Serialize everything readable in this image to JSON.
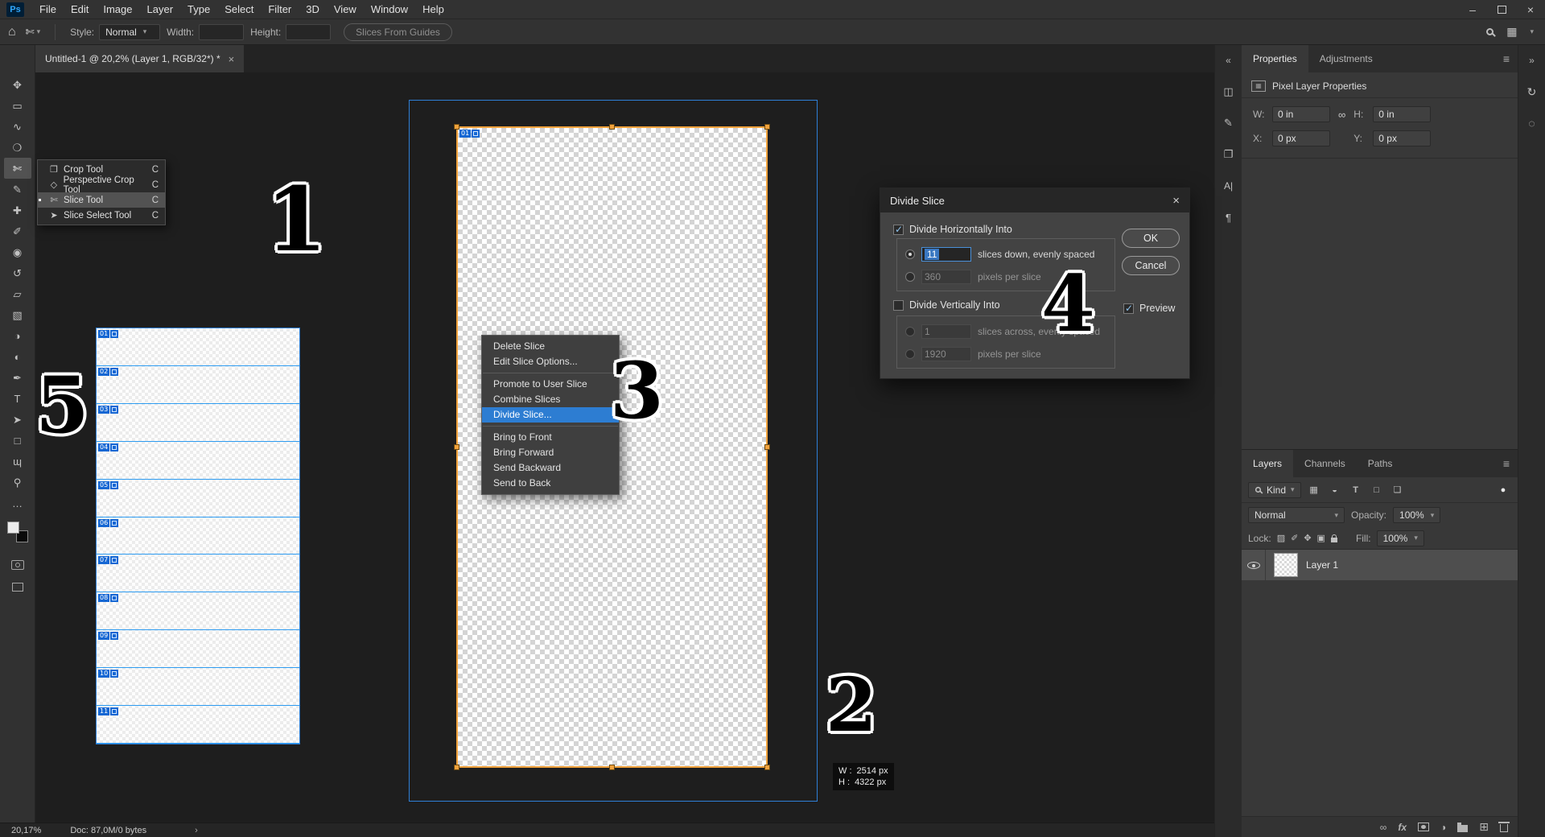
{
  "window": {
    "minimize_label": "–",
    "close_label": "×"
  },
  "menubar": {
    "logo": "Ps",
    "items": [
      "File",
      "Edit",
      "Image",
      "Layer",
      "Type",
      "Select",
      "Filter",
      "3D",
      "View",
      "Window",
      "Help"
    ]
  },
  "options_bar": {
    "style_label": "Style:",
    "style_value": "Normal",
    "width_label": "Width:",
    "width_value": "",
    "height_label": "Height:",
    "height_value": "",
    "slices_from_guides_label": "Slices From Guides"
  },
  "document_tab": {
    "title": "Untitled-1 @ 20,2% (Layer 1, RGB/32*) *",
    "close": "×"
  },
  "toolbar": {
    "tools": [
      {
        "name": "move-tool",
        "glyph": "✥"
      },
      {
        "name": "rectangular-marquee-tool",
        "glyph": "▭"
      },
      {
        "name": "lasso-tool",
        "glyph": "∿"
      },
      {
        "name": "quick-selection-tool",
        "glyph": "❍"
      },
      {
        "name": "slice-tool",
        "glyph": "✄",
        "active": true
      },
      {
        "name": "eyedropper-tool",
        "glyph": "✎"
      },
      {
        "name": "spot-healing-brush-tool",
        "glyph": "✚"
      },
      {
        "name": "brush-tool",
        "glyph": "✐"
      },
      {
        "name": "clone-stamp-tool",
        "glyph": "◉"
      },
      {
        "name": "history-brush-tool",
        "glyph": "↺"
      },
      {
        "name": "eraser-tool",
        "glyph": "▱"
      },
      {
        "name": "gradient-tool",
        "glyph": "▧"
      },
      {
        "name": "blur-tool",
        "glyph": "◑"
      },
      {
        "name": "dodge-tool",
        "glyph": "◐"
      },
      {
        "name": "pen-tool",
        "glyph": "✒"
      },
      {
        "name": "type-tool",
        "glyph": "T"
      },
      {
        "name": "path-selection-tool",
        "glyph": "➤"
      },
      {
        "name": "rectangle-tool",
        "glyph": "□"
      },
      {
        "name": "hand-tool",
        "glyph": "ɰ"
      },
      {
        "name": "zoom-tool",
        "glyph": "⚲"
      },
      {
        "name": "edit-toolbar",
        "glyph": "…"
      }
    ]
  },
  "tool_flyout": {
    "items": [
      {
        "label": "Crop Tool",
        "shortcut": "C",
        "glyph": "❐"
      },
      {
        "label": "Perspective Crop Tool",
        "shortcut": "C",
        "glyph": "◇"
      },
      {
        "label": "Slice Tool",
        "shortcut": "C",
        "glyph": "✄",
        "selected": true
      },
      {
        "label": "Slice Select Tool",
        "shortcut": "C",
        "glyph": "➤"
      }
    ]
  },
  "context_menu": {
    "items": [
      "Delete Slice",
      "Edit Slice Options...",
      "Promote to User Slice",
      "Combine Slices",
      "Divide Slice...",
      "Bring to Front",
      "Bring Forward",
      "Send Backward",
      "Send to Back"
    ]
  },
  "divide_dialog": {
    "title": "Divide Slice",
    "close": "×",
    "horizontal_label": "Divide Horizontally Into",
    "h_slices_value": "11",
    "h_slices_label": "slices down, evenly spaced",
    "h_pixels_value": "360",
    "h_pixels_label": "pixels per slice",
    "vertical_label": "Divide Vertically Into",
    "v_slices_value": "1",
    "v_slices_label": "slices across, evenly spaced",
    "v_pixels_value": "1920",
    "v_pixels_label": "pixels per slice",
    "ok_label": "OK",
    "cancel_label": "Cancel",
    "preview_label": "Preview"
  },
  "canvas": {
    "main_slice_badge": "01",
    "preview_slices": [
      "01",
      "02",
      "03",
      "04",
      "05",
      "06",
      "07",
      "08",
      "09",
      "10",
      "11"
    ],
    "size_tooltip": {
      "w_label": "W :",
      "w_value": "2514 px",
      "h_label": "H :",
      "h_value": "4322 px"
    }
  },
  "annotations": {
    "n1": "1",
    "n2": "2",
    "n3": "3",
    "n4": "4",
    "n5": "5"
  },
  "properties_panel": {
    "tabs": [
      "Properties",
      "Adjustments"
    ],
    "header": "Pixel Layer Properties",
    "w_label": "W:",
    "w_value": "0 in",
    "h_label": "H:",
    "h_value": "0 in",
    "x_label": "X:",
    "x_value": "0 px",
    "y_label": "Y:",
    "y_value": "0 px"
  },
  "layers_panel": {
    "tabs": [
      "Layers",
      "Channels",
      "Paths"
    ],
    "kind_label": "Kind",
    "blend_mode": "Normal",
    "opacity_label": "Opacity:",
    "opacity_value": "100%",
    "lock_label": "Lock:",
    "fill_label": "Fill:",
    "fill_value": "100%",
    "layer_name": "Layer 1",
    "fx_label": "fx"
  },
  "status_bar": {
    "zoom": "20,17%",
    "doc": "Doc: 87,0M/0 bytes",
    "expand": "›"
  },
  "colors": {
    "accent_blue": "#1473e6",
    "slice_blue": "#2d9bf0",
    "selection_orange": "#f1a23c",
    "highlight_blue": "#2d7dd2"
  }
}
